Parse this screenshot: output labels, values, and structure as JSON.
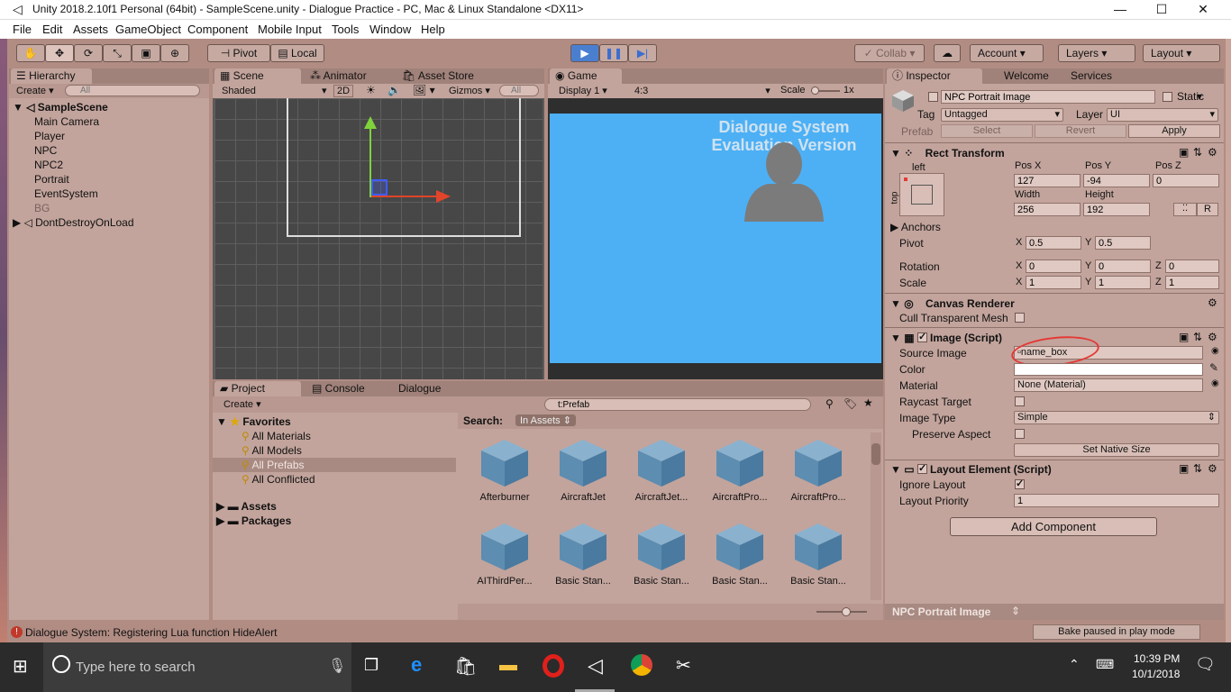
{
  "window": {
    "title": "Unity 2018.2.10f1 Personal (64bit) - SampleScene.unity - Dialogue Practice - PC, Mac & Linux Standalone <DX11>",
    "controls": {
      "minimize": "—",
      "maximize": "☐",
      "close": "✕"
    }
  },
  "menu": [
    "File",
    "Edit",
    "Assets",
    "GameObject",
    "Component",
    "Mobile Input",
    "Tools",
    "Window",
    "Help"
  ],
  "toolbar": {
    "pivot": "Pivot",
    "local": "Local",
    "collab": "Collab",
    "account": "Account",
    "layers": "Layers",
    "layout": "Layout"
  },
  "hierarchy": {
    "tab": "Hierarchy",
    "create": "Create",
    "search_placeholder": "All",
    "scene": "SampleScene",
    "items": [
      "Main Camera",
      "Player",
      "NPC",
      "NPC2",
      "Portrait",
      "EventSystem",
      "BG"
    ],
    "ddol": "DontDestroyOnLoad"
  },
  "scene": {
    "tabs": [
      "Scene",
      "Animator",
      "Asset Store"
    ],
    "shading": "Shaded",
    "mode2d": "2D",
    "gizmos": "Gizmos",
    "search_placeholder": "All"
  },
  "game": {
    "tab": "Game",
    "display": "Display 1",
    "aspect": "4:3",
    "scale_label": "Scale",
    "scale_value": "1x",
    "overlay_line1": "Dialogue System",
    "overlay_line2": "Evaluation Version"
  },
  "project": {
    "tabs": [
      "Project",
      "Console",
      "Dialogue"
    ],
    "create": "Create",
    "search_value": "t:Prefab",
    "favorites_label": "Favorites",
    "favorites": [
      "All Materials",
      "All Models",
      "All Prefabs",
      "All Conflicted"
    ],
    "assets": "Assets",
    "packages": "Packages",
    "search_label": "Search:",
    "search_scope": "In Assets",
    "items": [
      "Afterburner",
      "AircraftJet",
      "AircraftJet...",
      "AircraftPro...",
      "AircraftPro...",
      "AIThirdPer...",
      "Basic Stan...",
      "Basic Stan...",
      "Basic Stan...",
      "Basic Stan..."
    ]
  },
  "inspector": {
    "tabs": [
      "Inspector",
      "Welcome",
      "Services"
    ],
    "object_name": "NPC Portrait Image",
    "static_label": "Static",
    "tag_label": "Tag",
    "tag_value": "Untagged",
    "layer_label": "Layer",
    "layer_value": "UI",
    "prefab_label": "Prefab",
    "prefab_select": "Select",
    "prefab_revert": "Revert",
    "prefab_apply": "Apply",
    "rect_transform": {
      "title": "Rect Transform",
      "anchor_h": "left",
      "anchor_v": "top",
      "posx_label": "Pos X",
      "posx": "127",
      "posy_label": "Pos Y",
      "posy": "-94",
      "posz_label": "Pos Z",
      "posz": "0",
      "width_label": "Width",
      "width": "256",
      "height_label": "Height",
      "height": "192",
      "raw_btn": "R",
      "anchors": "Anchors",
      "pivot_label": "Pivot",
      "pivot_x": "0.5",
      "pivot_y": "0.5",
      "rotation_label": "Rotation",
      "rot_x": "0",
      "rot_y": "0",
      "rot_z": "0",
      "scale_label": "Scale",
      "scale_x": "1",
      "scale_y": "1",
      "scale_z": "1"
    },
    "canvas_renderer": {
      "title": "Canvas Renderer",
      "cull_label": "Cull Transparent Mesh"
    },
    "image": {
      "title": "Image (Script)",
      "source_label": "Source Image",
      "source_value": "name_box",
      "color_label": "Color",
      "material_label": "Material",
      "material_value": "None (Material)",
      "raycast_label": "Raycast Target",
      "type_label": "Image Type",
      "type_value": "Simple",
      "preserve_label": "Preserve Aspect",
      "native_btn": "Set Native Size"
    },
    "layout_element": {
      "title": "Layout Element (Script)",
      "ignore_label": "Ignore Layout",
      "priority_label": "Layout Priority",
      "priority_value": "1"
    },
    "add_component": "Add Component",
    "footer_name": "NPC Portrait Image",
    "bake_status": "Bake paused in play mode"
  },
  "status": "Dialogue System: Registering Lua function HideAlert",
  "taskbar": {
    "search_placeholder": "Type here to search",
    "time": "10:39 PM",
    "date": "10/1/2018"
  },
  "colors": {
    "game_bg": "#4db0f5",
    "editor_bg": "#b08c83",
    "highlight": "#e53935"
  }
}
